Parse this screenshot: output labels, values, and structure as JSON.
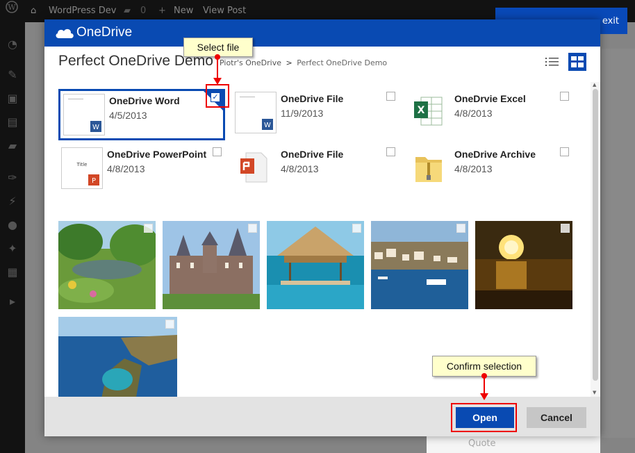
{
  "admin_bar": {
    "site_name": "WordPress Dev",
    "comments_count": "0",
    "new_label": "New",
    "view_post_label": "View Post"
  },
  "background": {
    "exit_label": "exit",
    "quote_label": "Quote"
  },
  "dialog": {
    "brand": "OneDrive",
    "title": "Perfect OneDrive Demo",
    "breadcrumb": {
      "root": "Piotr's OneDrive",
      "separator": ">",
      "current": "Perfect OneDrive Demo"
    },
    "files": [
      {
        "name": "OneDrive Word",
        "date": "4/5/2013",
        "type": "word-doc",
        "selected": true
      },
      {
        "name": "OneDrive File",
        "date": "11/9/2013",
        "type": "word-doc",
        "selected": false
      },
      {
        "name": "OneDrvie Excel",
        "date": "4/8/2013",
        "type": "excel",
        "selected": false
      },
      {
        "name": "OneDrive PowerPoint",
        "date": "4/8/2013",
        "type": "powerpoint",
        "selected": false
      },
      {
        "name": "OneDrive File",
        "date": "4/8/2013",
        "type": "pdf",
        "selected": false
      },
      {
        "name": "OneDrive Archive",
        "date": "4/8/2013",
        "type": "zip-folder",
        "selected": false
      }
    ],
    "photos": [
      {
        "subject": "garden-pond"
      },
      {
        "subject": "castle"
      },
      {
        "subject": "thatched-hut-in-water"
      },
      {
        "subject": "harbour-town"
      },
      {
        "subject": "sunset-sea"
      },
      {
        "subject": "coastal-bay"
      }
    ],
    "buttons": {
      "open": "Open",
      "cancel": "Cancel"
    },
    "colors": {
      "accent": "#094ab2",
      "highlight": "#ee0000",
      "callout": "#ffffcc"
    }
  },
  "annotations": {
    "select_file": "Select file",
    "confirm_selection": "Confirm selection"
  }
}
